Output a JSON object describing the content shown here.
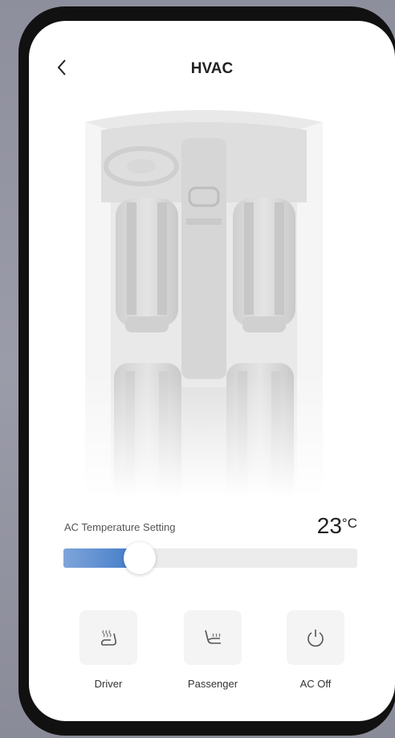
{
  "header": {
    "title": "HVAC",
    "back_icon": "chevron-left-icon"
  },
  "temperature": {
    "label": "AC Temperature Setting",
    "value": "23",
    "unit": "°C",
    "slider_fraction": 0.26,
    "accent_color": "#3f79c8"
  },
  "controls": [
    {
      "label": "Driver",
      "icon": "seat-heat-icon"
    },
    {
      "label": "Passenger",
      "icon": "seat-ventilation-icon"
    },
    {
      "label": "AC Off",
      "icon": "power-icon"
    }
  ]
}
